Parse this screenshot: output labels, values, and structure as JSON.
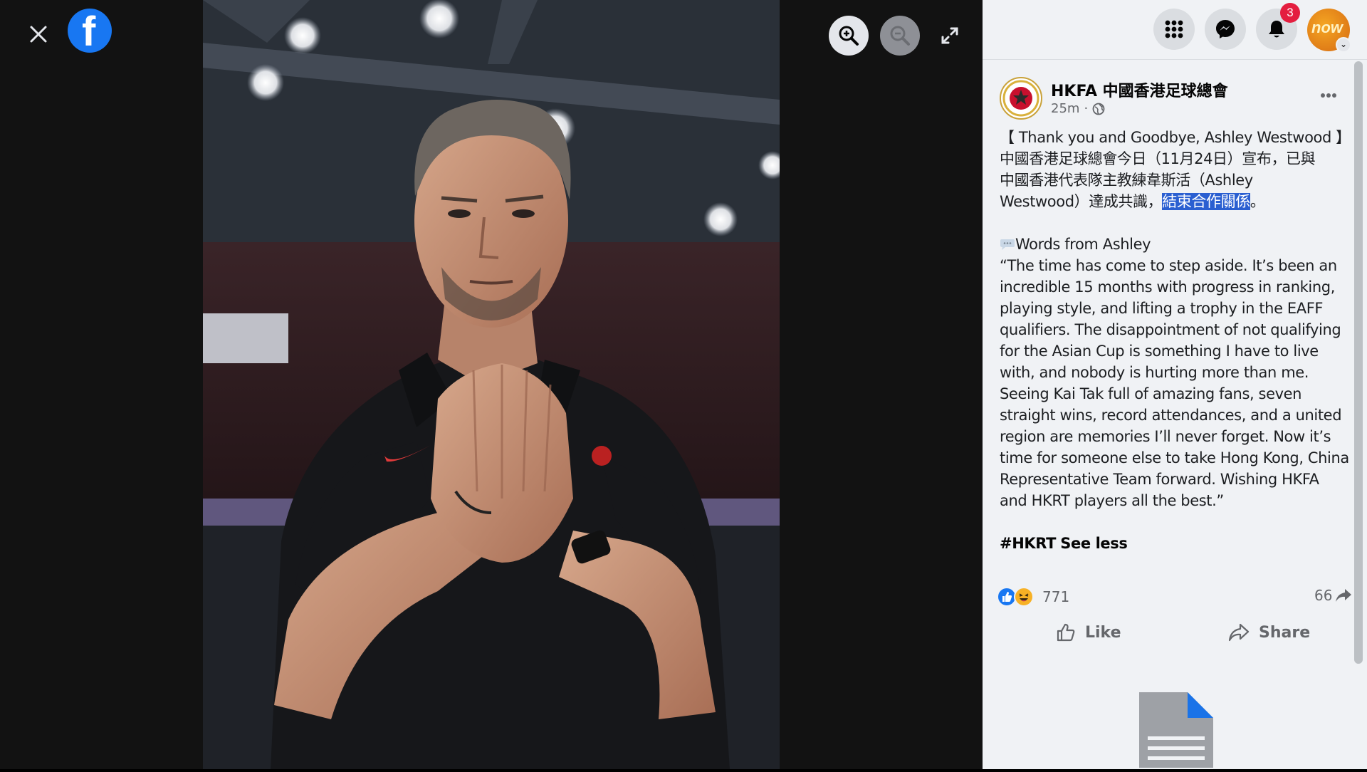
{
  "viewer": {
    "close_icon": "close-icon",
    "logo_icon": "facebook-logo",
    "logo_letter": "f",
    "zoom_in_icon": "zoom-in-icon",
    "zoom_out_icon": "zoom-out-icon",
    "fullscreen_icon": "fullscreen-icon"
  },
  "topbar": {
    "menu_icon": "grid-menu-icon",
    "messenger_icon": "messenger-icon",
    "notifications_icon": "bell-icon",
    "notification_count": "3",
    "account_label": "now"
  },
  "post": {
    "page_name": "HKFA 中國香港足球總會",
    "time": "25m",
    "separator": "·",
    "privacy_icon": "globe-icon",
    "lines_cn": [
      "【 Thank you and Goodbye, Ashley Westwood 】",
      "中國香港足球總會今日（11月24日）宣布，已與",
      "中國香港代表隊主教練韋斯活（Ashley",
      "Westwood）達成共識，"
    ],
    "highlighted": "結束合作關係",
    "cn_end": "。",
    "words_heading": "Words from Ashley",
    "quote": "“The time has come to step aside. It’s been an incredible 15 months with progress in ranking, playing style, and lifting a trophy in the EAFF qualifiers. The disappointment of not qualifying for the Asian Cup is something I have to live with, and nobody is hurting more than me. Seeing Kai Tak full of amazing fans, seven straight wins, record attendances, and a united region are memories I’ll never forget. Now it’s time for someone else to take Hong Kong, China Representative Team forward. Wishing HKFA and HKRT players all the best.”",
    "hashtag": "#HKRT",
    "see_less": "See less",
    "reaction_count": "771",
    "share_count": "66",
    "like_label": "Like",
    "share_label": "Share"
  },
  "colors": {
    "facebook_blue": "#1877f2",
    "highlight": "#2a5fd1",
    "badge_red": "#e41e3f",
    "panel_bg": "#f0f2f5"
  }
}
